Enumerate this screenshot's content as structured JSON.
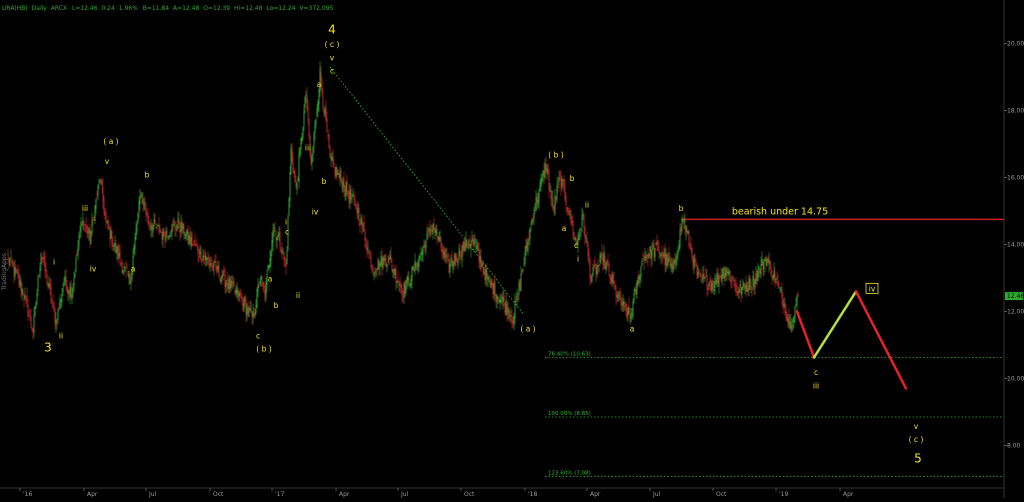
{
  "header": {
    "symbol": "URA(HB)",
    "interval": "Daily",
    "exchange": "ARCX",
    "last": "L=12.46",
    "change": "0.24",
    "change_pct": "1.96%",
    "bid": "B=11.84",
    "ask": "A=12.48",
    "open": "O=12.39",
    "high": "Hi=12.48",
    "low": "Lo=12.24",
    "volume": "V=372,095"
  },
  "watermark": "TradingApps",
  "colors": {
    "up_candle": "#2ea82e",
    "down_candle": "#c0282c",
    "wave_label": "#f2e21a",
    "fib_line": "#2bb82b",
    "resistance": "#c81e1e",
    "projection_down": "#e8202a",
    "projection_up": "#b4e03a",
    "price_tag": "#2ea82e"
  },
  "chart_data": {
    "type": "candlestick",
    "title": "",
    "xlabel": "",
    "ylabel": "",
    "x_ticks": [
      "'16",
      "Apr",
      "Jul",
      "Oct",
      "'17",
      "Apr",
      "Jul",
      "Oct",
      "'18",
      "Apr",
      "Jul",
      "Oct",
      "'19",
      "Apr"
    ],
    "y_ticks": [
      "20.00",
      "18.00",
      "16.00",
      "14.00",
      "12.00",
      "10.00",
      "8.00"
    ],
    "ylim": [
      6.1,
      20.8
    ],
    "last_price": "12.46",
    "grid": false,
    "price_anchors": [
      {
        "d": 0,
        "p": 13.6
      },
      {
        "d": 15,
        "p": 12.6
      },
      {
        "d": 25,
        "p": 11.4
      },
      {
        "d": 33,
        "p": 13.8
      },
      {
        "d": 40,
        "p": 12.8
      },
      {
        "d": 48,
        "p": 11.7
      },
      {
        "d": 56,
        "p": 12.9
      },
      {
        "d": 64,
        "p": 12.6
      },
      {
        "d": 74,
        "p": 14.8
      },
      {
        "d": 82,
        "p": 14.2
      },
      {
        "d": 92,
        "p": 16.0
      },
      {
        "d": 98,
        "p": 14.6
      },
      {
        "d": 115,
        "p": 13.3
      },
      {
        "d": 122,
        "p": 12.9
      },
      {
        "d": 133,
        "p": 15.6
      },
      {
        "d": 140,
        "p": 14.7
      },
      {
        "d": 155,
        "p": 14.3
      },
      {
        "d": 170,
        "p": 14.6
      },
      {
        "d": 185,
        "p": 14.0
      },
      {
        "d": 200,
        "p": 13.5
      },
      {
        "d": 215,
        "p": 13.0
      },
      {
        "d": 232,
        "p": 12.4
      },
      {
        "d": 245,
        "p": 11.8
      },
      {
        "d": 252,
        "p": 13.0
      },
      {
        "d": 257,
        "p": 12.5
      },
      {
        "d": 265,
        "p": 14.5
      },
      {
        "d": 272,
        "p": 14.1
      },
      {
        "d": 278,
        "p": 13.3
      },
      {
        "d": 283,
        "p": 16.8
      },
      {
        "d": 288,
        "p": 15.6
      },
      {
        "d": 298,
        "p": 18.5
      },
      {
        "d": 303,
        "p": 16.3
      },
      {
        "d": 312,
        "p": 19.1
      },
      {
        "d": 322,
        "p": 16.5
      },
      {
        "d": 335,
        "p": 15.8
      },
      {
        "d": 350,
        "p": 15.0
      },
      {
        "d": 365,
        "p": 13.3
      },
      {
        "d": 380,
        "p": 13.6
      },
      {
        "d": 395,
        "p": 12.6
      },
      {
        "d": 410,
        "p": 13.5
      },
      {
        "d": 425,
        "p": 14.6
      },
      {
        "d": 440,
        "p": 13.3
      },
      {
        "d": 455,
        "p": 13.9
      },
      {
        "d": 465,
        "p": 14.1
      },
      {
        "d": 480,
        "p": 12.9
      },
      {
        "d": 495,
        "p": 12.3
      },
      {
        "d": 505,
        "p": 11.8
      },
      {
        "d": 515,
        "p": 13.3
      },
      {
        "d": 525,
        "p": 14.9
      },
      {
        "d": 538,
        "p": 16.4
      },
      {
        "d": 545,
        "p": 15.0
      },
      {
        "d": 552,
        "p": 16.0
      },
      {
        "d": 560,
        "p": 15.1
      },
      {
        "d": 568,
        "p": 14.0
      },
      {
        "d": 575,
        "p": 14.8
      },
      {
        "d": 583,
        "p": 13.0
      },
      {
        "d": 595,
        "p": 13.6
      },
      {
        "d": 610,
        "p": 12.4
      },
      {
        "d": 622,
        "p": 11.8
      },
      {
        "d": 635,
        "p": 13.6
      },
      {
        "d": 650,
        "p": 13.9
      },
      {
        "d": 665,
        "p": 13.2
      },
      {
        "d": 675,
        "p": 14.8
      },
      {
        "d": 690,
        "p": 13.0
      },
      {
        "d": 705,
        "p": 12.8
      },
      {
        "d": 718,
        "p": 13.3
      },
      {
        "d": 730,
        "p": 12.6
      },
      {
        "d": 745,
        "p": 12.9
      },
      {
        "d": 758,
        "p": 13.6
      },
      {
        "d": 770,
        "p": 12.8
      },
      {
        "d": 782,
        "p": 11.6
      },
      {
        "d": 790,
        "p": 12.46
      }
    ],
    "wave_labels": [
      {
        "text": "3",
        "d": 40,
        "p": 10.8,
        "size": "big"
      },
      {
        "text": "i",
        "d": 46,
        "p": 13.4
      },
      {
        "text": "ii",
        "d": 53,
        "p": 11.2
      },
      {
        "text": "iii",
        "d": 77,
        "p": 15.0
      },
      {
        "text": "iv",
        "d": 85,
        "p": 13.2
      },
      {
        "text": "( a )",
        "d": 103,
        "p": 17.0
      },
      {
        "text": "v",
        "d": 99,
        "p": 16.4
      },
      {
        "text": "a",
        "d": 125,
        "p": 13.2
      },
      {
        "text": "b",
        "d": 139,
        "p": 16.0
      },
      {
        "text": "c",
        "d": 250,
        "p": 11.2
      },
      {
        "text": "( b )",
        "d": 256,
        "p": 10.8
      },
      {
        "text": "a",
        "d": 262,
        "p": 12.9
      },
      {
        "text": "b",
        "d": 268,
        "p": 12.1
      },
      {
        "text": "i",
        "d": 278,
        "p": 14.6
      },
      {
        "text": "c",
        "d": 279,
        "p": 14.3
      },
      {
        "text": "ii",
        "d": 290,
        "p": 12.4
      },
      {
        "text": "iii",
        "d": 300,
        "p": 16.8
      },
      {
        "text": "iv",
        "d": 307,
        "p": 14.9
      },
      {
        "text": "a",
        "d": 311,
        "p": 18.7
      },
      {
        "text": "b",
        "d": 316,
        "p": 15.8
      },
      {
        "text": "4",
        "d": 324,
        "p": 20.3,
        "size": "big"
      },
      {
        "text": "( c )",
        "d": 324,
        "p": 19.9
      },
      {
        "text": "v",
        "d": 324,
        "p": 19.5
      },
      {
        "text": "c",
        "d": 324,
        "p": 19.1
      },
      {
        "text": "( a )",
        "d": 520,
        "p": 11.4
      },
      {
        "text": "( b )",
        "d": 548,
        "p": 16.6
      },
      {
        "text": "b",
        "d": 564,
        "p": 15.9
      },
      {
        "text": "ii",
        "d": 579,
        "p": 15.1
      },
      {
        "text": "a",
        "d": 556,
        "p": 14.4
      },
      {
        "text": "c",
        "d": 568,
        "p": 13.9
      },
      {
        "text": "i",
        "d": 570,
        "p": 13.5
      },
      {
        "text": "a",
        "d": 624,
        "p": 11.4
      },
      {
        "text": "b",
        "d": 673,
        "p": 15.0
      },
      {
        "text": "c",
        "d": 808,
        "p": 10.1
      },
      {
        "text": "iii",
        "d": 808,
        "p": 9.7
      },
      {
        "text": "iv",
        "d": 864,
        "p": 12.6,
        "boxed": true
      },
      {
        "text": "v",
        "d": 908,
        "p": 8.5
      },
      {
        "text": "( c )",
        "d": 908,
        "p": 8.1
      },
      {
        "text": "5",
        "d": 910,
        "p": 7.5,
        "size": "big"
      }
    ],
    "annotations": [
      {
        "type": "text",
        "text": "bearish under 14.75",
        "d": 772,
        "p": 14.9
      }
    ],
    "trendlines": [
      {
        "name": "wave-c-decline",
        "from": {
          "d": 322,
          "p": 19.3
        },
        "to": {
          "d": 516,
          "p": 11.9
        },
        "style": "dotted"
      }
    ],
    "resistance": {
      "price": 14.75,
      "from_d": 673,
      "to_d": 1030,
      "label": "bearish under 14.75"
    },
    "fib_levels": [
      {
        "label": "76.40% (10.63)",
        "price": 10.63
      },
      {
        "label": "100.00% (8.85)",
        "price": 8.85
      },
      {
        "label": "123.60% (7.08)",
        "price": 7.08
      }
    ],
    "projection": [
      {
        "d": 789,
        "p": 12.0
      },
      {
        "d": 806,
        "p": 10.63
      },
      {
        "d": 848,
        "p": 12.6
      },
      {
        "d": 898,
        "p": 9.7
      }
    ]
  }
}
